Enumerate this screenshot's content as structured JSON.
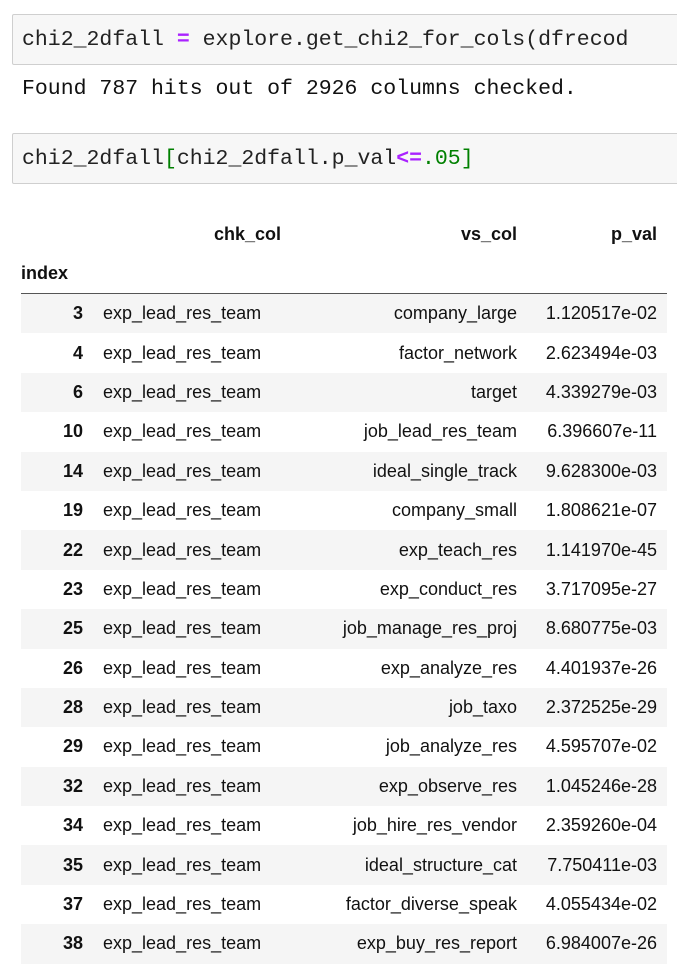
{
  "cells": [
    {
      "code_parts": [
        "chi2_2dfall ",
        "=",
        " explore.get_chi2_for_cols(dfrecod"
      ]
    },
    {
      "code_parts": [
        "chi2_2dfall",
        "[",
        "chi2_2dfall.p_val",
        "<=",
        ".05",
        "]"
      ]
    }
  ],
  "output_text": "Found 787 hits out of 2926 columns checked.",
  "table": {
    "columns": [
      "chk_col",
      "vs_col",
      "p_val"
    ],
    "index_name": "index",
    "rows": [
      {
        "index": "3",
        "chk_col": "exp_lead_res_team",
        "vs_col": "company_large",
        "p_val": "1.120517e-02"
      },
      {
        "index": "4",
        "chk_col": "exp_lead_res_team",
        "vs_col": "factor_network",
        "p_val": "2.623494e-03"
      },
      {
        "index": "6",
        "chk_col": "exp_lead_res_team",
        "vs_col": "target",
        "p_val": "4.339279e-03"
      },
      {
        "index": "10",
        "chk_col": "exp_lead_res_team",
        "vs_col": "job_lead_res_team",
        "p_val": "6.396607e-11"
      },
      {
        "index": "14",
        "chk_col": "exp_lead_res_team",
        "vs_col": "ideal_single_track",
        "p_val": "9.628300e-03"
      },
      {
        "index": "19",
        "chk_col": "exp_lead_res_team",
        "vs_col": "company_small",
        "p_val": "1.808621e-07"
      },
      {
        "index": "22",
        "chk_col": "exp_lead_res_team",
        "vs_col": "exp_teach_res",
        "p_val": "1.141970e-45"
      },
      {
        "index": "23",
        "chk_col": "exp_lead_res_team",
        "vs_col": "exp_conduct_res",
        "p_val": "3.717095e-27"
      },
      {
        "index": "25",
        "chk_col": "exp_lead_res_team",
        "vs_col": "job_manage_res_proj",
        "p_val": "8.680775e-03"
      },
      {
        "index": "26",
        "chk_col": "exp_lead_res_team",
        "vs_col": "exp_analyze_res",
        "p_val": "4.401937e-26"
      },
      {
        "index": "28",
        "chk_col": "exp_lead_res_team",
        "vs_col": "job_taxo",
        "p_val": "2.372525e-29"
      },
      {
        "index": "29",
        "chk_col": "exp_lead_res_team",
        "vs_col": "job_analyze_res",
        "p_val": "4.595707e-02"
      },
      {
        "index": "32",
        "chk_col": "exp_lead_res_team",
        "vs_col": "exp_observe_res",
        "p_val": "1.045246e-28"
      },
      {
        "index": "34",
        "chk_col": "exp_lead_res_team",
        "vs_col": "job_hire_res_vendor",
        "p_val": "2.359260e-04"
      },
      {
        "index": "35",
        "chk_col": "exp_lead_res_team",
        "vs_col": "ideal_structure_cat",
        "p_val": "7.750411e-03"
      },
      {
        "index": "37",
        "chk_col": "exp_lead_res_team",
        "vs_col": "factor_diverse_speak",
        "p_val": "4.055434e-02"
      },
      {
        "index": "38",
        "chk_col": "exp_lead_res_team",
        "vs_col": "exp_buy_res_report",
        "p_val": "6.984007e-26"
      }
    ]
  },
  "colors": {
    "operator": "#aa22ff",
    "number": "#008000",
    "cell_background": "#f7f7f7",
    "row_stripe": "#f5f5f5"
  }
}
